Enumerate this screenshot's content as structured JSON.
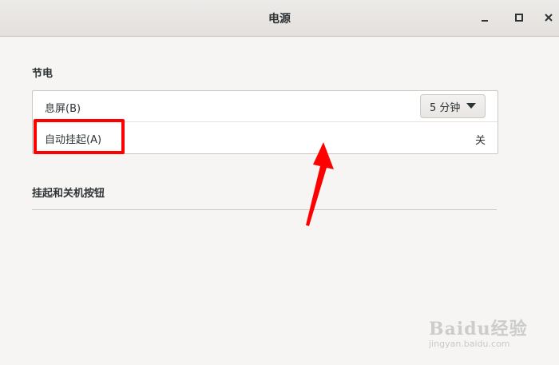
{
  "window": {
    "title": "电源"
  },
  "power_saving": {
    "section_title": "节电",
    "blank_screen": {
      "label": "息屏(B)",
      "value": "5 分钟"
    },
    "auto_suspend": {
      "label": "自动挂起(A)",
      "value": "关"
    }
  },
  "buttons_section": {
    "section_title": "挂起和关机按钮"
  },
  "annotation": {
    "color": "#ff0000"
  },
  "watermark": {
    "brand": "Baidu经验",
    "url": "jingyan.baidu.com"
  }
}
